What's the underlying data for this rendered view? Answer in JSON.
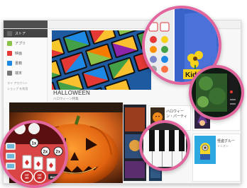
{
  "sidebar": {
    "items": [
      {
        "label": "ストア",
        "color": "#4f4f4f",
        "active": true
      },
      {
        "label": "アプリ",
        "color": "#8bc34a",
        "active": false
      },
      {
        "label": "映画",
        "color": "#e53935",
        "active": false
      },
      {
        "label": "書籍",
        "color": "#1e88e5",
        "active": false
      },
      {
        "label": "端末",
        "color": "#757575",
        "active": false
      }
    ],
    "sub_items": [
      "マイ アカウント",
      "ショップ を利用"
    ]
  },
  "hero": {
    "title": "HALLOWEEN",
    "subtitle": "ハロウィーン特集"
  },
  "cards": [
    {
      "title": "ハロウィーン・パーティ",
      "sub": ""
    },
    {
      "title": "",
      "sub": ""
    },
    {
      "title": "怪盗グルー",
      "sub": "ミニオン"
    }
  ],
  "circles": {
    "kids_label": "Kids",
    "card_buttons": [
      "HIT ME",
      "HIT ME",
      "BUSTED"
    ],
    "card_badges": [
      "1x",
      "2x",
      "2x"
    ]
  },
  "colors": {
    "accent_pink": "#e2669d",
    "sidebar_active": "#444444"
  }
}
